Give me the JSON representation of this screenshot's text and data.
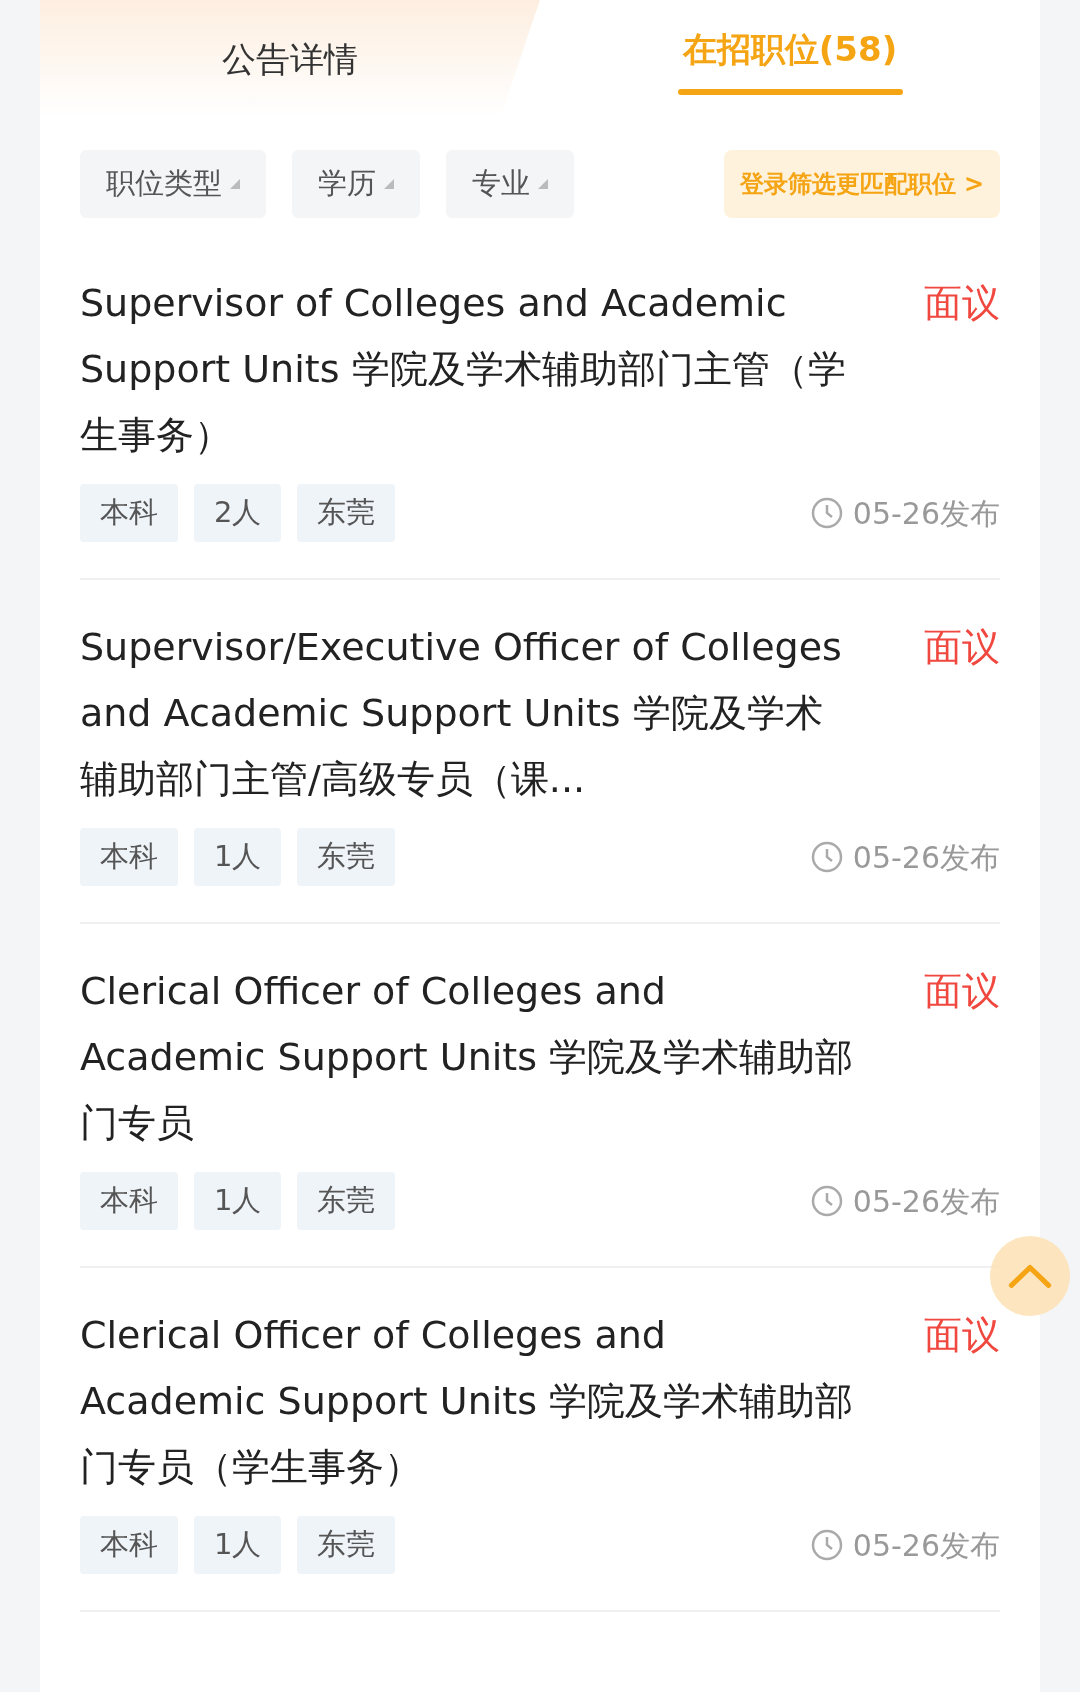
{
  "tabs": [
    {
      "label": "公告详情",
      "selected": false
    },
    {
      "label": "在招职位(58)",
      "selected": true
    }
  ],
  "filters": [
    {
      "label": "职位类型"
    },
    {
      "label": "学历"
    },
    {
      "label": "专业"
    }
  ],
  "login_filter": "登录筛选更匹配职位 >",
  "jobs": [
    {
      "title": "Supervisor of Colleges and Academic Support Units 学院及学术辅助部门主管（学生事务）",
      "salary": "面议",
      "tags": [
        "本科",
        "2人",
        "东莞"
      ],
      "time": "05-26发布"
    },
    {
      "title": "Supervisor/Executive Officer of Colleges and Academic Support Units 学院及学术辅助部门主管/高级专员（课...",
      "salary": "面议",
      "tags": [
        "本科",
        "1人",
        "东莞"
      ],
      "time": "05-26发布"
    },
    {
      "title": "Clerical Officer of Colleges and Academic Support Units 学院及学术辅助部门专员",
      "salary": "面议",
      "tags": [
        "本科",
        "1人",
        "东莞"
      ],
      "time": "05-26发布"
    },
    {
      "title": "Clerical Officer of Colleges and Academic Support Units 学院及学术辅助部门专员（学生事务）",
      "salary": "面议",
      "tags": [
        "本科",
        "1人",
        "东莞"
      ],
      "time": "05-26发布"
    }
  ]
}
